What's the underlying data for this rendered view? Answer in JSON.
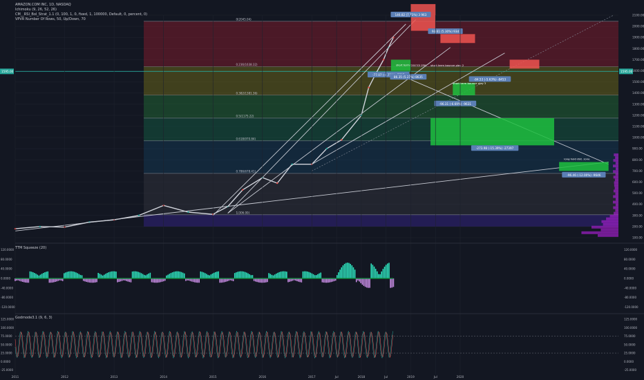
{
  "header": {
    "symbol": "AMAZON.COM INC, 1D, NASDAQ",
    "indicators": [
      "Ichimoku (9, 26, 52, 26)",
      "CM__RSI_Bol_Strat_1.1 (0, 100, 1, 0, fixed, 1, 100000, Default, 0, percent, 0)",
      "VPVR Number Of Rows, 50, Up/Down, 70"
    ]
  },
  "colors": {
    "background": "#131722",
    "grid": "#1e222d",
    "price": "#d1d4dc",
    "bull": "#26a69a",
    "bear": "#ef5350",
    "trendline": "#c8cbd4",
    "label_bg": "#5b7fb5",
    "squeeze_up": "#2ee6c0",
    "squeeze_down": "#c98de6",
    "vpvr": "#a020c8"
  },
  "chart_data": [
    {
      "type": "line",
      "title": "AMAZON.COM INC, 1D, NASDAQ",
      "price_last": "1595.00",
      "y_ticks": [
        "2100.00",
        "2000.00",
        "1900.00",
        "1800.00",
        "1700.00",
        "1600.00",
        "1500.00",
        "1400.00",
        "1300.00",
        "1200.00",
        "1100.00",
        "1000.00",
        "900.00",
        "800.00",
        "700.00",
        "600.00",
        "500.00",
        "400.00",
        "300.00",
        "200.00",
        "100.00"
      ],
      "ylim": [
        100,
        2100
      ],
      "x_ticks": [
        "2011",
        "2012",
        "2013",
        "2014",
        "2015",
        "2016",
        "2017",
        "Jul",
        "2018",
        "Jul",
        "2019",
        "Jul",
        "2020"
      ],
      "x": [
        2011.0,
        2011.5,
        2012.0,
        2012.5,
        2013.0,
        2013.5,
        2014.0,
        2014.5,
        2015.0,
        2015.3,
        2015.6,
        2016.0,
        2016.3,
        2016.6,
        2017.0,
        2017.3,
        2017.6,
        2018.0,
        2018.15,
        2018.3,
        2018.45,
        2018.55,
        2018.65
      ],
      "close": [
        180,
        200,
        195,
        240,
        260,
        300,
        390,
        330,
        310,
        380,
        530,
        640,
        590,
        760,
        760,
        900,
        980,
        1200,
        1450,
        1580,
        1700,
        1810,
        1900
      ],
      "fib_levels": [
        {
          "label": "0(2045.04)",
          "value": 2045
        },
        {
          "label": "0.236(1638.32)",
          "value": 1638
        },
        {
          "label": "0.382(1381.36)",
          "value": 1381
        },
        {
          "label": "0.5(1175.22)",
          "value": 1175
        },
        {
          "label": "0.618(970.84)",
          "value": 971
        },
        {
          "label": "0.786(678.41)",
          "value": 678
        },
        {
          "label": "1(306.00)",
          "value": 306
        }
      ],
      "annotations": [
        {
          "text": "146.82 (7.73%) 3 963",
          "x": 2019.0,
          "y": 2100
        },
        {
          "text": "93.61 (5.30%) 93d",
          "x": 2019.7,
          "y": 1950
        },
        {
          "text": "-77.07 (-4.71%) -7707",
          "x": 2018.55,
          "y": 1560
        },
        {
          "text": "86.35 (5.27%) 8635",
          "x": 2018.95,
          "y": 1540
        },
        {
          "text": "-84.53 (-5.63%) -8453",
          "x": 2020.6,
          "y": 1520
        },
        {
          "text": "-96.31 (-6.69%) -9631",
          "x": 2019.9,
          "y": 1300
        },
        {
          "text": "-273.98 (-15.39%) -27397",
          "x": 2020.7,
          "y": 900
        },
        {
          "text": "-96.46 (-12.00%) -9646",
          "x": 2022.5,
          "y": 660
        }
      ],
      "notes": [
        {
          "text": "short term bounce play",
          "x": 2018.7,
          "y": 1645
        },
        {
          "text": "short term bounce play 2",
          "x": 2019.4,
          "y": 1640
        },
        {
          "text": "short term bounce play 3",
          "x": 2019.85,
          "y": 1480
        },
        {
          "text": "long hold dist. zone",
          "x": 2022.1,
          "y": 800
        }
      ]
    },
    {
      "type": "area",
      "title": "TTM Squeeze (20)",
      "y_ticks": [
        "120.0000",
        "80.0000",
        "40.0000",
        "0.0000",
        "-40.0000",
        "-80.0000",
        "-120.0000"
      ],
      "ylim": [
        -130,
        130
      ]
    },
    {
      "type": "line",
      "title": "Godmode3.1 (9, 6, 3)",
      "y_ticks": [
        "125.0000",
        "100.0000",
        "75.0000",
        "50.0000",
        "25.0000",
        "0.0000",
        "-25.0000"
      ],
      "ylim": [
        -30,
        125
      ]
    }
  ]
}
